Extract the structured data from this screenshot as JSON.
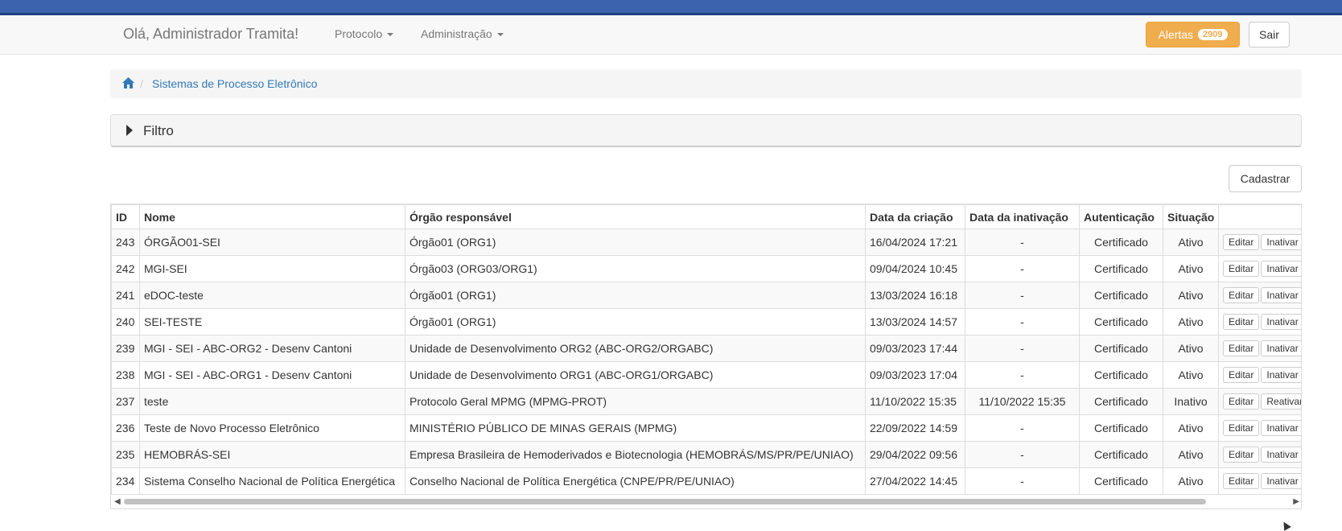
{
  "navbar": {
    "greeting": "Olá, Administrador Tramita!",
    "menu": [
      {
        "label": "Protocolo"
      },
      {
        "label": "Administração"
      }
    ],
    "alerts_label": "Alertas",
    "alerts_count": "2909",
    "logout_label": "Sair"
  },
  "breadcrumb": {
    "current": "Sistemas de Processo Eletrônico"
  },
  "filter": {
    "label": "Filtro"
  },
  "actions": {
    "register_label": "Cadastrar"
  },
  "table": {
    "headers": [
      "ID",
      "Nome",
      "Órgão responsável",
      "Data da criação",
      "Data da inativação",
      "Autenticação",
      "Situação",
      ""
    ],
    "edit_label": "Editar",
    "rows": [
      {
        "id": "243",
        "nome": "ÓRGÃO01-SEI",
        "orgao": "Órgão01 (ORG1)",
        "criacao": "16/04/2024 17:21",
        "inativacao": "-",
        "autenticacao": "Certificado",
        "situacao": "Ativo",
        "action": "Inativar"
      },
      {
        "id": "242",
        "nome": "MGI-SEI",
        "orgao": "Órgão03 (ORG03/ORG1)",
        "criacao": "09/04/2024 10:45",
        "inativacao": "-",
        "autenticacao": "Certificado",
        "situacao": "Ativo",
        "action": "Inativar"
      },
      {
        "id": "241",
        "nome": "eDOC-teste",
        "orgao": "Órgão01 (ORG1)",
        "criacao": "13/03/2024 16:18",
        "inativacao": "-",
        "autenticacao": "Certificado",
        "situacao": "Ativo",
        "action": "Inativar"
      },
      {
        "id": "240",
        "nome": "SEI-TESTE",
        "orgao": "Órgão01 (ORG1)",
        "criacao": "13/03/2024 14:57",
        "inativacao": "-",
        "autenticacao": "Certificado",
        "situacao": "Ativo",
        "action": "Inativar"
      },
      {
        "id": "239",
        "nome": "MGI - SEI - ABC-ORG2 - Desenv Cantoni",
        "orgao": "Unidade de Desenvolvimento ORG2 (ABC-ORG2/ORGABC)",
        "criacao": "09/03/2023 17:44",
        "inativacao": "-",
        "autenticacao": "Certificado",
        "situacao": "Ativo",
        "action": "Inativar"
      },
      {
        "id": "238",
        "nome": "MGI - SEI - ABC-ORG1 - Desenv Cantoni",
        "orgao": "Unidade de Desenvolvimento ORG1 (ABC-ORG1/ORGABC)",
        "criacao": "09/03/2023 17:04",
        "inativacao": "-",
        "autenticacao": "Certificado",
        "situacao": "Ativo",
        "action": "Inativar"
      },
      {
        "id": "237",
        "nome": "teste",
        "orgao": "Protocolo Geral MPMG (MPMG-PROT)",
        "criacao": "11/10/2022 15:35",
        "inativacao": "11/10/2022 15:35",
        "autenticacao": "Certificado",
        "situacao": "Inativo",
        "action": "Reativar"
      },
      {
        "id": "236",
        "nome": "Teste de Novo Processo Eletrônico",
        "orgao": "MINISTÉRIO PÚBLICO DE MINAS GERAIS (MPMG)",
        "criacao": "22/09/2022 14:59",
        "inativacao": "-",
        "autenticacao": "Certificado",
        "situacao": "Ativo",
        "action": "Inativar"
      },
      {
        "id": "235",
        "nome": "HEMOBRÁS-SEI",
        "orgao": "Empresa Brasileira de Hemoderivados e Biotecnologia (HEMOBRÁS/MS/PR/PE/UNIAO)",
        "criacao": "29/04/2022 09:56",
        "inativacao": "-",
        "autenticacao": "Certificado",
        "situacao": "Ativo",
        "action": "Inativar"
      },
      {
        "id": "234",
        "nome": "Sistema Conselho Nacional de Política Energética",
        "orgao": "Conselho Nacional de Política Energética (CNPE/PR/PE/UNIAO)",
        "criacao": "27/04/2022 14:45",
        "inativacao": "-",
        "autenticacao": "Certificado",
        "situacao": "Ativo",
        "action": "Inativar"
      }
    ]
  },
  "colors": {
    "topbar": "#3c63ad",
    "alert": "#f0ad4e",
    "link": "#337ab7"
  },
  "icons": [
    "home-icon",
    "caret-down-icon",
    "caret-right-icon"
  ]
}
